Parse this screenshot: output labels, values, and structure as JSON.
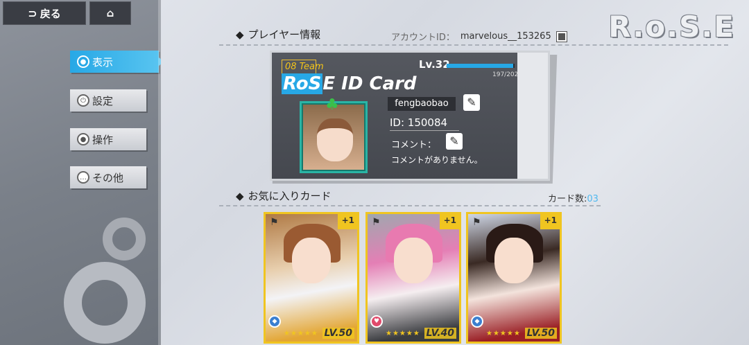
{
  "topbar": {
    "back_label": "戻る",
    "back_icon": "back-arrow-icon",
    "home_icon": "home-icon"
  },
  "logo": "R.o.S.E",
  "sidebar": {
    "items": [
      {
        "label": "表示",
        "icon": "user-circle-icon",
        "active": true
      },
      {
        "label": "設定",
        "icon": "power-icon",
        "active": false
      },
      {
        "label": "操作",
        "icon": "user-circle-icon",
        "active": false
      },
      {
        "label": "その他",
        "icon": "more-dots-icon",
        "active": false
      }
    ]
  },
  "player_section": {
    "title": "プレイヤー情報",
    "account_label": "アカウントID：",
    "account_id": "marvelous__153265"
  },
  "id_card": {
    "team": "08  Team",
    "title_highlight": "RoS",
    "title_rest": "E ID Card",
    "level": "Lv.32",
    "exp": "197/202",
    "exp_fraction": 0.975,
    "name": "fengbaobao",
    "id_text": "ID:  150084",
    "comment_label": "コメント：",
    "comment_text": "コメントがありません。",
    "accent_color": "#27a8e6",
    "team_color": "#f5c518"
  },
  "favorites": {
    "title": "お気に入りカード",
    "count_label": "カード数:",
    "count_value": "03",
    "cards": [
      {
        "plus": "+1",
        "level": "LV.50",
        "stars": "★★★★★",
        "elem_color": "#3b7fd0"
      },
      {
        "plus": "+1",
        "level": "LV.40",
        "stars": "★★★★★",
        "elem_color": "#e14a6b"
      },
      {
        "plus": "+1",
        "level": "LV.50",
        "stars": "★★★★★",
        "elem_color": "#3b7fd0"
      }
    ]
  }
}
